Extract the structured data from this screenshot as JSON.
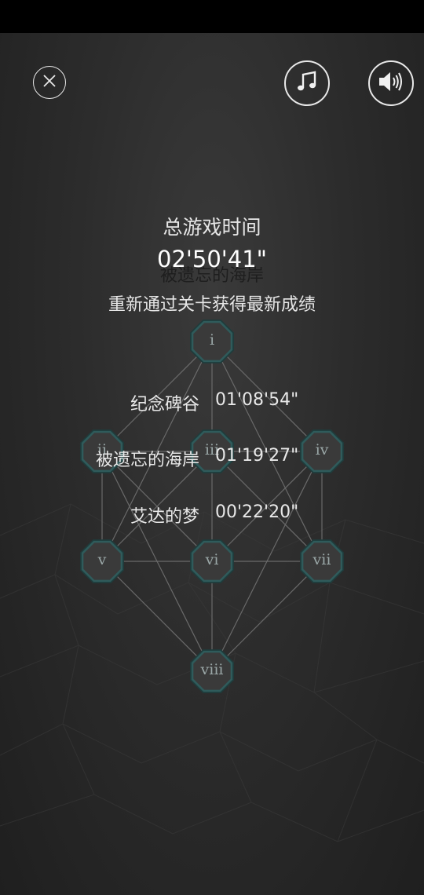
{
  "controls": {
    "close_icon": "close-icon",
    "music_icon": "music-note-icon",
    "sound_icon": "speaker-icon"
  },
  "colors": {
    "background": "#2b2b2b",
    "node_fill": "#3a3a3a",
    "node_stroke": "#2f5b5b",
    "text": "#e6e6e6"
  },
  "stats": {
    "total_label": "总游戏时间",
    "total_time": "02'50'41\"",
    "hidden_chapter_title": "被遗忘的海岸",
    "hint": "重新通过关卡获得最新成绩",
    "chapters": [
      {
        "name": "纪念碑谷",
        "time": "01'08'54\""
      },
      {
        "name": "被遗忘的海岸",
        "time": "01'19'27\""
      },
      {
        "name": "艾达的梦",
        "time": "00'22'20\""
      }
    ]
  },
  "level_graph": {
    "nodes": [
      {
        "id": "i",
        "label": "i"
      },
      {
        "id": "ii",
        "label": "ii"
      },
      {
        "id": "iii",
        "label": "iii"
      },
      {
        "id": "iv",
        "label": "iv"
      },
      {
        "id": "v",
        "label": "v"
      },
      {
        "id": "vi",
        "label": "vi"
      },
      {
        "id": "vii",
        "label": "vii"
      },
      {
        "id": "viii",
        "label": "viii"
      }
    ]
  }
}
